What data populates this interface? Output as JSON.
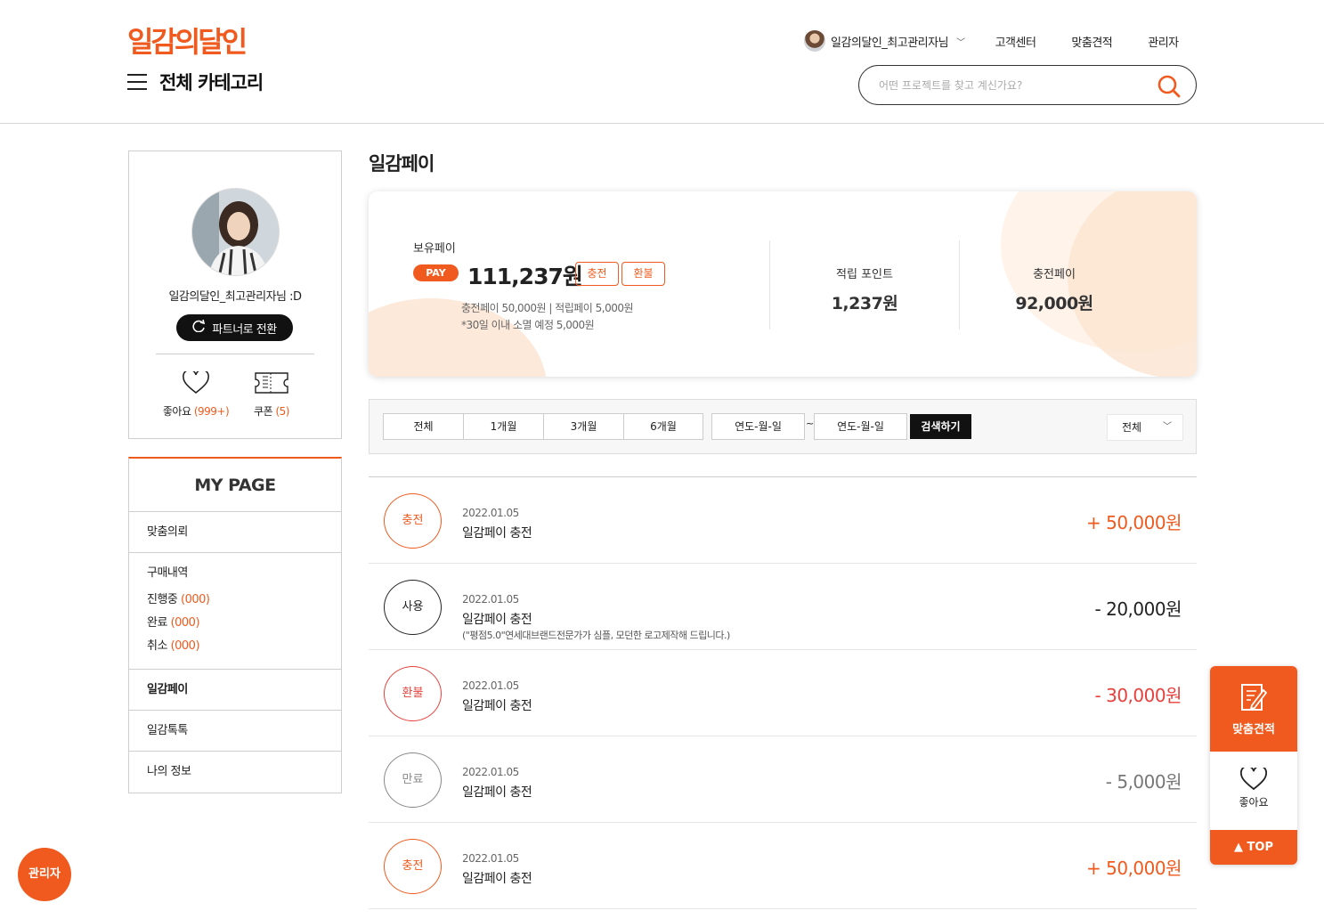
{
  "header": {
    "logo": "일감의달인",
    "category_label": "전체 카테고리",
    "user_name": "일감의달인_최고관리자님",
    "nav": [
      "고객센터",
      "맞춤견적",
      "관리자"
    ],
    "search_placeholder": "어떤 프로젝트를 찾고 계신가요?"
  },
  "profile": {
    "name": "일감의달인_최고관리자님 :D",
    "switch_label": "파트너로 전환",
    "likes_label": "좋아요",
    "likes_count": "(999+)",
    "coupon_label": "쿠폰",
    "coupon_count": "(5)"
  },
  "mypage": {
    "title": "MY PAGE",
    "custom_request": "맞춤의뢰",
    "purchase_history": "구매내역",
    "in_progress": "진행중",
    "in_progress_count": "(000)",
    "completed": "완료",
    "completed_count": "(000)",
    "cancelled": "취소",
    "cancelled_count": "(000)",
    "pay": "일감페이",
    "talk": "일감톡톡",
    "my_info": "나의 정보"
  },
  "main": {
    "title": "일감페이",
    "balance_label": "보유페이",
    "pay_badge": "PAY",
    "balance": "111,237원",
    "charge_btn": "충전",
    "refund_btn": "환불",
    "sub_line1": "충전페이 50,000원 | 적립페이 5,000원",
    "sub_line2": "*30일 이내 소멸 예정 5,000원",
    "points_label": "적립 포인트",
    "points_value": "1,237원",
    "charged_label": "충전페이",
    "charged_value": "92,000원"
  },
  "filter": {
    "periods": [
      "전체",
      "1개월",
      "3개월",
      "6개월"
    ],
    "date_from": "연도-월-일",
    "date_to": "연도-월-일",
    "tilde": "~",
    "search_btn": "검색하기",
    "select_value": "전체"
  },
  "transactions": [
    {
      "type": "충전",
      "date": "2022.01.05",
      "title": "일감페이 충전",
      "note": "",
      "amount": "+ 50,000원",
      "color": "#f05a1e",
      "amount_color": "#f05a1e"
    },
    {
      "type": "사용",
      "date": "2022.01.05",
      "title": "일감페이 충전",
      "note": "(\"평점5.0\"연세대브랜드전문가가 심플, 모던한 로고제작해 드립니다.)",
      "amount": "- 20,000원",
      "color": "#222222",
      "amount_color": "#222222"
    },
    {
      "type": "환불",
      "date": "2022.01.05",
      "title": "일감페이 충전",
      "note": "",
      "amount": "- 30,000원",
      "color": "#e8413c",
      "amount_color": "#e8413c"
    },
    {
      "type": "만료",
      "date": "2022.01.05",
      "title": "일감페이 충전",
      "note": "",
      "amount": "- 5,000원",
      "color": "#888888",
      "amount_color": "#777777"
    },
    {
      "type": "충전",
      "date": "2022.01.05",
      "title": "일감페이 충전",
      "note": "",
      "amount": "+ 50,000원",
      "color": "#f05a1e",
      "amount_color": "#f05a1e"
    }
  ],
  "floating": {
    "estimate": "맞춤견적",
    "likes": "좋아요",
    "top": "▲ TOP"
  },
  "admin_fab": "관리자",
  "colors": {
    "accent": "#f05a1e"
  }
}
